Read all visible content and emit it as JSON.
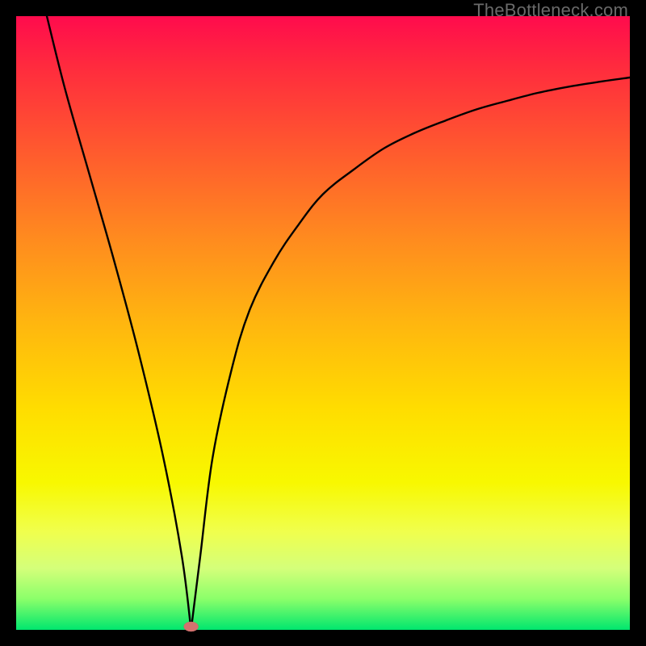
{
  "watermark": "TheBottleneck.com",
  "chart_data": {
    "type": "line",
    "title": "",
    "xlabel": "",
    "ylabel": "",
    "xlim": [
      0,
      100
    ],
    "ylim": [
      0,
      100
    ],
    "grid": false,
    "legend": false,
    "annotations": [
      {
        "text": "TheBottleneck.com",
        "position": "top-right"
      }
    ],
    "series": [
      {
        "name": "bottleneck-curve",
        "x": [
          5,
          8,
          12,
          16,
          20,
          24,
          27,
          28.5,
          30,
          32,
          35,
          38,
          42,
          46,
          50,
          55,
          60,
          65,
          70,
          75,
          80,
          85,
          90,
          95,
          100
        ],
        "values": [
          100,
          88,
          74,
          60,
          45,
          28,
          12,
          0,
          12,
          28,
          42,
          52,
          60,
          66,
          71,
          75,
          78.5,
          81,
          83,
          84.8,
          86.2,
          87.5,
          88.5,
          89.3,
          90
        ]
      }
    ],
    "min_marker": {
      "x": 28.5,
      "y": 0
    },
    "background_gradient": {
      "direction": "vertical",
      "stops": [
        {
          "pos": 0,
          "color": "#ff0b4d"
        },
        {
          "pos": 0.5,
          "color": "#ffb60f"
        },
        {
          "pos": 0.78,
          "color": "#f8f800"
        },
        {
          "pos": 1.0,
          "color": "#00e66e"
        }
      ]
    }
  }
}
